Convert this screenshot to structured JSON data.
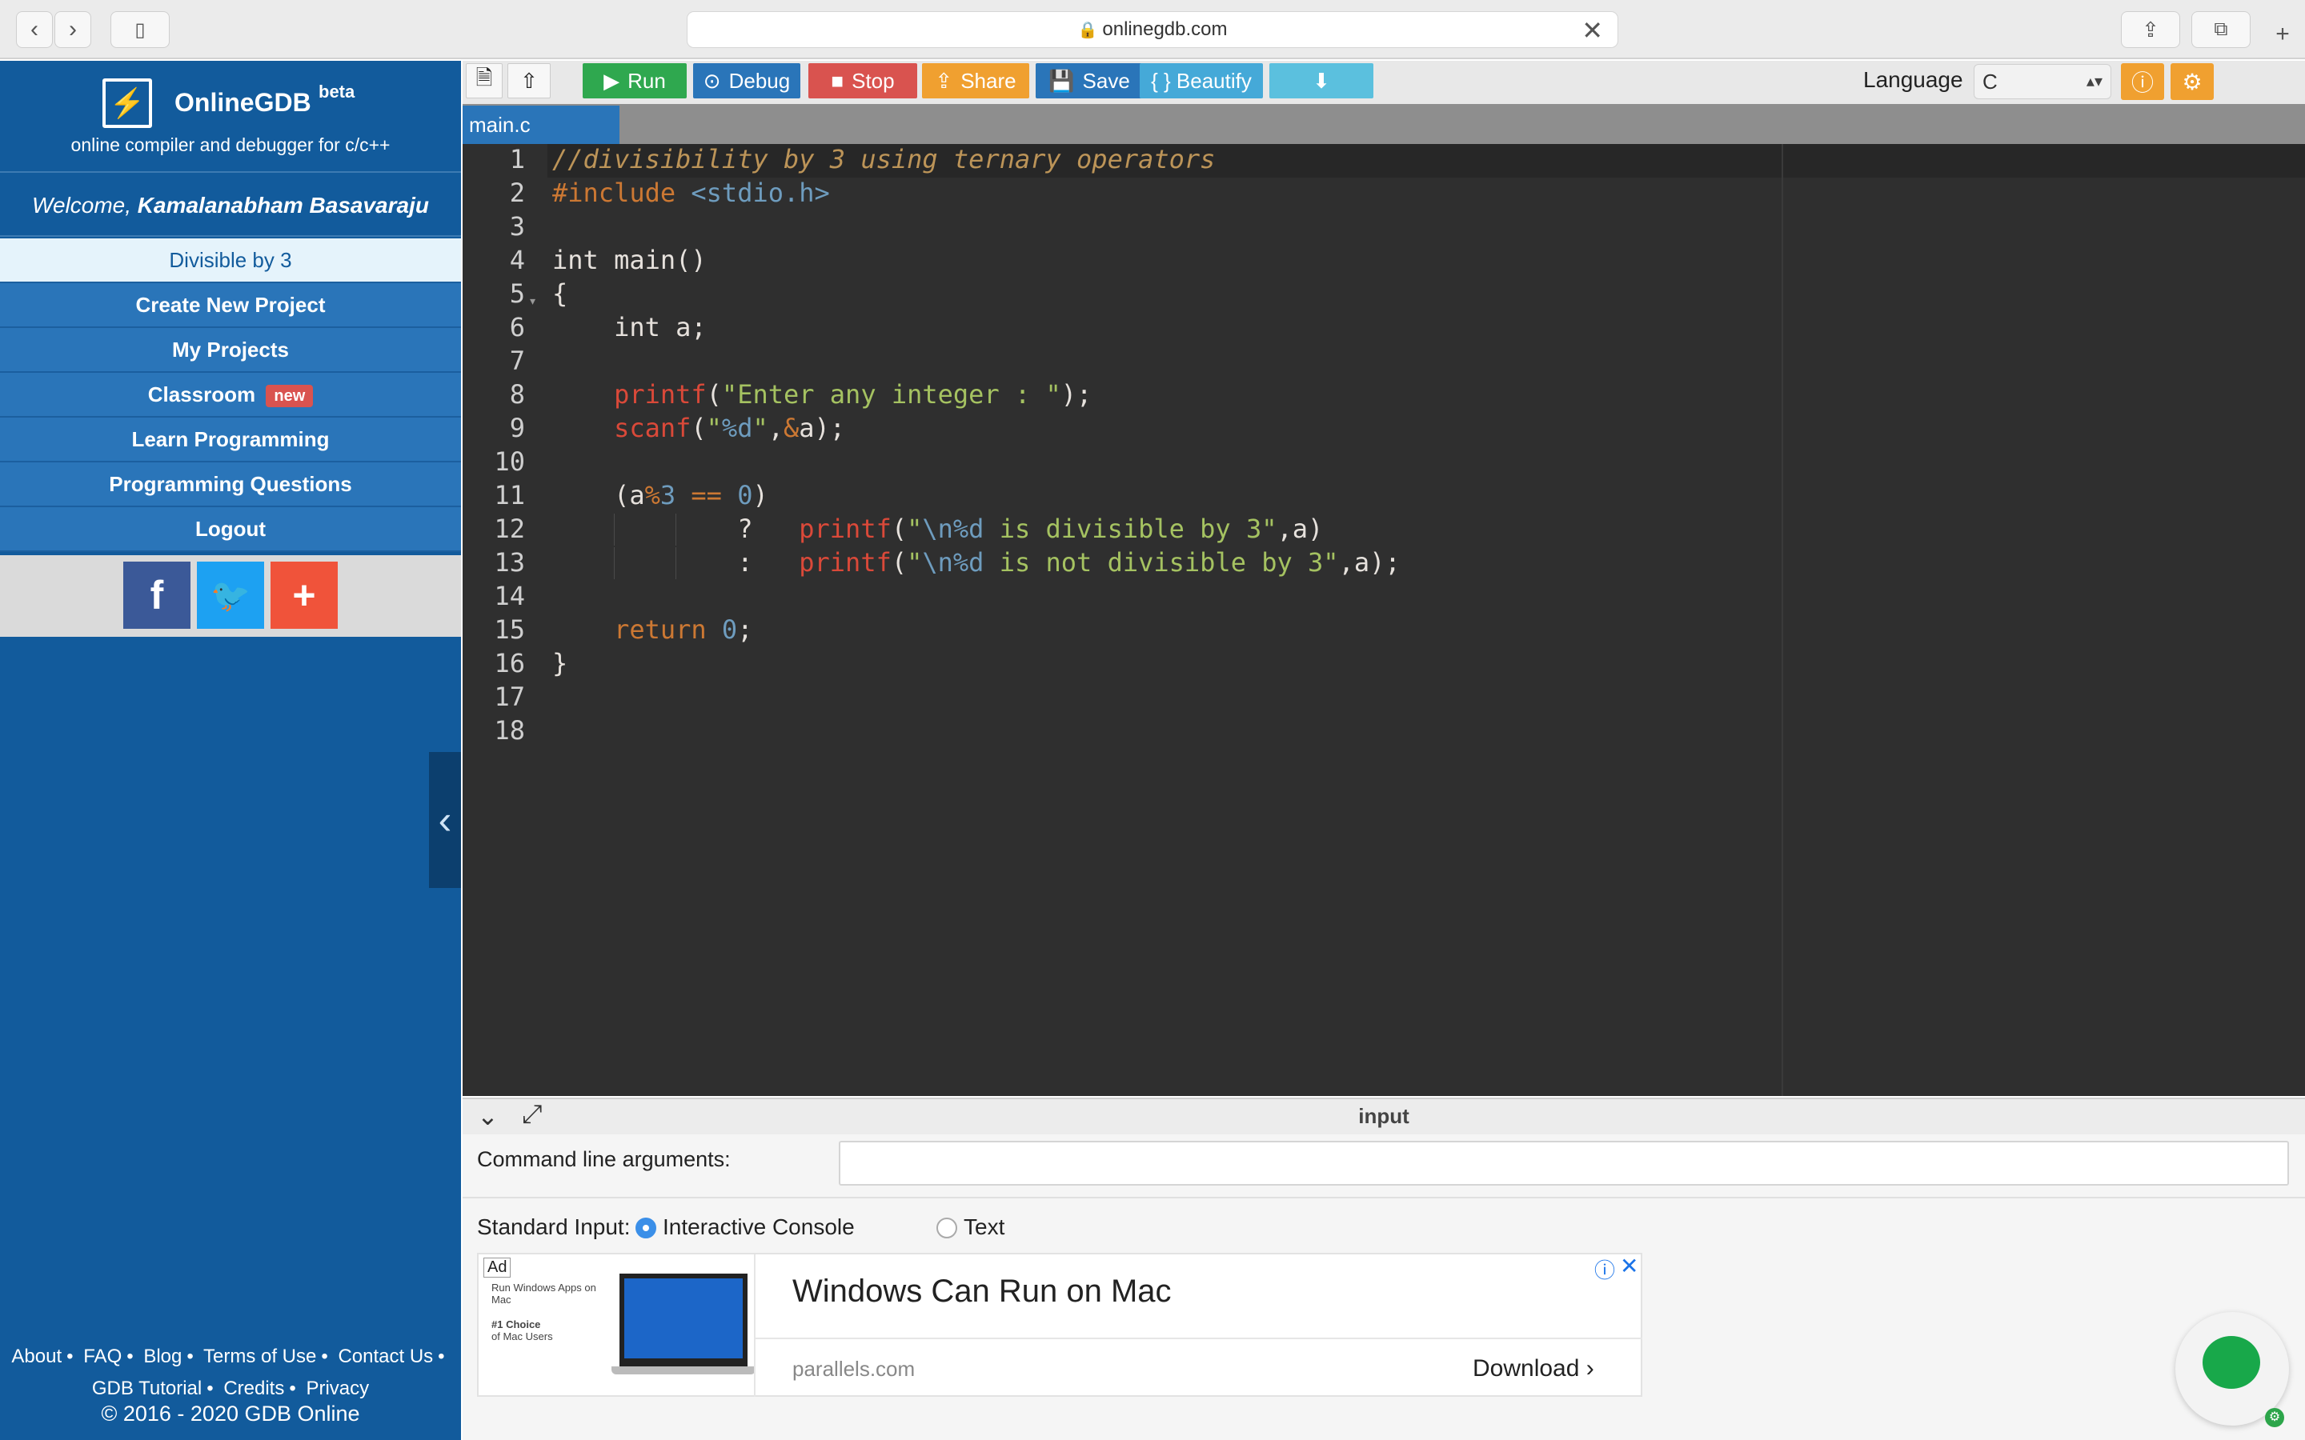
{
  "browser": {
    "url": "onlinegdb.com",
    "back_icon": "chevron-left-icon",
    "forward_icon": "chevron-right-icon",
    "sidebar_icon": "sidebar-icon",
    "share_icon": "share-icon",
    "tabs_icon": "tabs-icon",
    "new_tab": "+"
  },
  "brand": {
    "name": "OnlineGDB",
    "beta": "beta",
    "tagline": "online compiler and debugger for c/c++"
  },
  "welcome": {
    "prefix": "Welcome, ",
    "user": "Kamalanabham Basavaraju"
  },
  "nav": {
    "items": [
      {
        "label": "Divisible by 3",
        "active": true
      },
      {
        "label": "Create New Project"
      },
      {
        "label": "My Projects"
      },
      {
        "label": "Classroom",
        "badge": "new"
      },
      {
        "label": "Learn Programming"
      },
      {
        "label": "Programming Questions"
      },
      {
        "label": "Logout"
      }
    ]
  },
  "social": {
    "facebook": "f",
    "twitter": "🐦",
    "more": "+",
    "colors": {
      "facebook": "#3b5998",
      "twitter": "#1da1f2",
      "more": "#f0533a"
    }
  },
  "footer": {
    "links": [
      "About",
      "FAQ",
      "Blog",
      "Terms of Use",
      "Contact Us",
      "GDB Tutorial",
      "Credits",
      "Privacy"
    ],
    "sep": "•",
    "copyright": "© 2016 - 2020 GDB Online"
  },
  "toolbar": {
    "run": "Run",
    "debug": "Debug",
    "stop": "Stop",
    "share": "Share",
    "save": "Save",
    "beautify": "{ } Beautify",
    "language_label": "Language",
    "language_value": "C",
    "colors": {
      "run": "#2fa84f",
      "debug": "#2a75b9",
      "stop": "#d9534f",
      "share": "#f0a030",
      "save": "#2a75b9",
      "beautify": "#45a9d8",
      "download": "#5bc0de"
    }
  },
  "tabs": {
    "file": "main.c"
  },
  "editor": {
    "line_numbers": [
      "1",
      "2",
      "3",
      "4",
      "5",
      "6",
      "7",
      "8",
      "9",
      "10",
      "11",
      "12",
      "13",
      "14",
      "15",
      "16",
      "17",
      "18"
    ]
  },
  "input_panel": {
    "title": "input",
    "cmd_label": "Command line arguments:",
    "stdin_label": "Standard Input:",
    "option_interactive": "Interactive Console",
    "option_text": "Text",
    "selected": "Interactive Console"
  },
  "ad": {
    "tag": "Ad",
    "small1": "Run Windows Apps on Mac",
    "small2a": "#1 Choice",
    "small2b": "of Mac Users",
    "title": "Windows Can Run on Mac",
    "domain": "parallels.com",
    "cta": "Download",
    "info_icon": "ⓘ",
    "close_icon": "✕"
  }
}
